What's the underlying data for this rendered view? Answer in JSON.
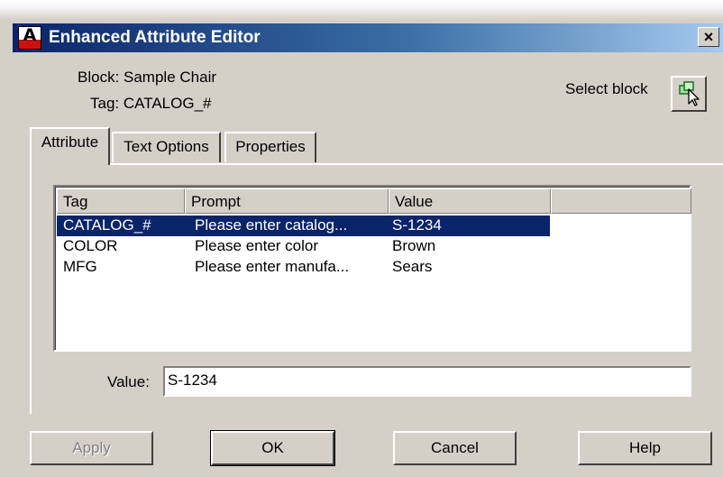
{
  "window": {
    "title": "Enhanced Attribute Editor",
    "close_label": "×",
    "icon_letter": "A"
  },
  "info": {
    "block_line": "Block: Sample Chair",
    "tag_line": "Tag: CATALOG_#"
  },
  "select_block": {
    "label": "Select block",
    "icon": "select-objects-icon"
  },
  "tabs": [
    {
      "label": "Attribute",
      "active": true
    },
    {
      "label": "Text Options",
      "active": false
    },
    {
      "label": "Properties",
      "active": false
    }
  ],
  "table": {
    "columns": [
      "Tag",
      "Prompt",
      "Value"
    ],
    "rows": [
      {
        "tag": "CATALOG_#",
        "prompt": "Please enter catalog...",
        "value": "S-1234",
        "selected": true
      },
      {
        "tag": "COLOR",
        "prompt": "Please enter color",
        "value": "Brown",
        "selected": false
      },
      {
        "tag": "MFG",
        "prompt": "Please enter manufa...",
        "value": "Sears",
        "selected": false
      }
    ]
  },
  "value_field": {
    "label": "Value:",
    "value": "S-1234"
  },
  "buttons": {
    "apply": "Apply",
    "ok": "OK",
    "cancel": "Cancel",
    "help": "Help"
  },
  "colors": {
    "selection": "#0a246a",
    "title_start": "#0a246a",
    "title_end": "#a6caf0",
    "face": "#d4d0c8"
  }
}
